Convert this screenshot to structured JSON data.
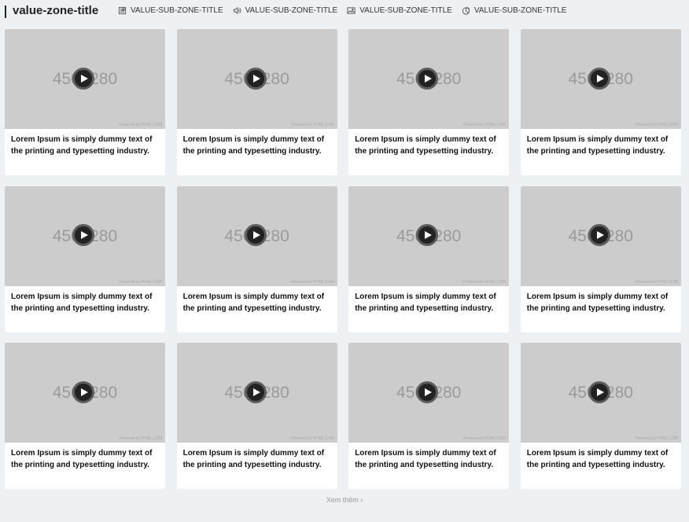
{
  "header": {
    "title": "value-zone-title",
    "sub_zones": [
      {
        "label": "VALUE-SUB-ZONE-TITLE",
        "icon": "document-icon"
      },
      {
        "label": "VALUE-SUB-ZONE-TITLE",
        "icon": "speaker-icon"
      },
      {
        "label": "VALUE-SUB-ZONE-TITLE",
        "icon": "image-icon"
      },
      {
        "label": "VALUE-SUB-ZONE-TITLE",
        "icon": "pie-chart-icon"
      }
    ]
  },
  "card_common": {
    "placeholder_text": "450×280",
    "powered_text": "Powered by HTML.COM"
  },
  "cards": [
    {
      "caption": "Lorem Ipsum is simply dummy text of the printing and typesetting industry."
    },
    {
      "caption": "Lorem Ipsum is simply dummy text of the printing and typesetting industry."
    },
    {
      "caption": "Lorem Ipsum is simply dummy text of the printing and typesetting industry."
    },
    {
      "caption": "Lorem Ipsum is simply dummy text of the printing and typesetting industry."
    },
    {
      "caption": "Lorem Ipsum is simply dummy text of the printing and typesetting industry."
    },
    {
      "caption": "Lorem Ipsum is simply dummy text of the printing and typesetting industry."
    },
    {
      "caption": "Lorem Ipsum is simply dummy text of the printing and typesetting industry."
    },
    {
      "caption": "Lorem Ipsum is simply dummy text of the printing and typesetting industry."
    },
    {
      "caption": "Lorem Ipsum is simply dummy text of the printing and typesetting industry."
    },
    {
      "caption": "Lorem Ipsum is simply dummy text of the printing and typesetting industry."
    },
    {
      "caption": "Lorem Ipsum is simply dummy text of the printing and typesetting industry."
    },
    {
      "caption": "Lorem Ipsum is simply dummy text of the printing and typesetting industry."
    }
  ],
  "more": {
    "label": "Xem thêm",
    "icon": "chevron-right-icon"
  }
}
